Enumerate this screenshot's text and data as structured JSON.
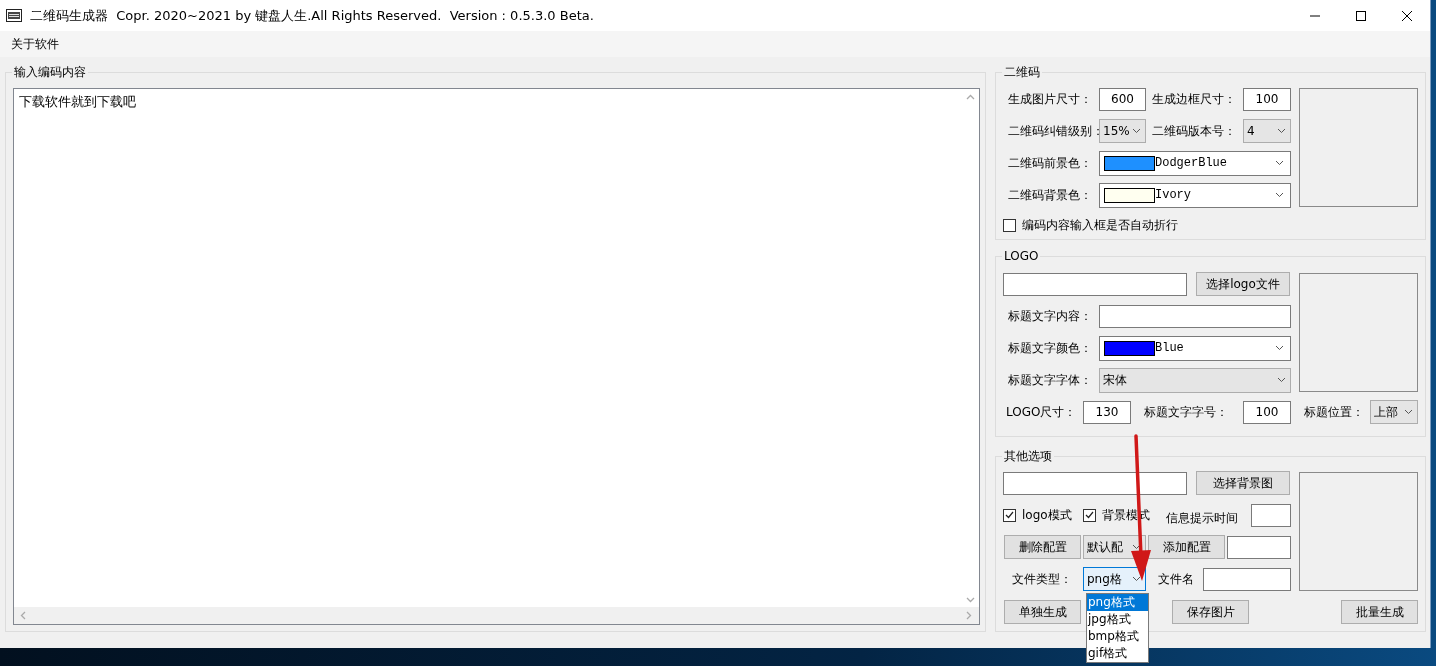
{
  "window": {
    "title": "二维码生成器  Copr. 2020~2021 by 键盘人生.All Rights Reserved.  Version : 0.5.3.0 Beta."
  },
  "menu": [
    {
      "label": "关于软件"
    }
  ],
  "input_group": {
    "title": "输入编码内容",
    "content": "下载软件就到下载吧"
  },
  "qr_code": {
    "title": "二维码",
    "image_size_label": "生成图片尺寸：",
    "image_size": "600",
    "border_size_label": "生成边框尺寸：",
    "border_size": "100",
    "error_level_label": "二维码纠错级别：",
    "error_level": "15%",
    "version_label": "二维码版本号：",
    "version": "4",
    "foreground_label": "二维码前景色：",
    "foreground": {
      "name": "DodgerBlue",
      "color": "#1e90ff"
    },
    "background_label": "二维码背景色：",
    "background": {
      "name": "Ivory",
      "color": "#fffff0"
    },
    "wrap_checkbox": {
      "label": "编码内容输入框是否自动折行",
      "checked": false
    }
  },
  "logo": {
    "title": "LOGO",
    "choose_button": "选择logo文件",
    "caption_label": "标题文字内容：",
    "color_label": "标题文字颜色：",
    "color": {
      "name": "Blue",
      "color": "#0000ff"
    },
    "font_label": "标题文字字体：",
    "font": "宋体",
    "size_label": "LOGO尺寸：",
    "size": "130",
    "font_size_label": "标题文字字号：",
    "font_size": "100",
    "position_label": "标题位置：",
    "position": "上部"
  },
  "other": {
    "title": "其他选项",
    "choose_button": "选择背景图",
    "checkboxes": [
      {
        "label": "logo模式",
        "checked": true
      },
      {
        "label": "背景模式",
        "checked": true
      }
    ],
    "tip_time_label": "信息提示时间",
    "delete_button": "删除配置",
    "config": "默认配",
    "add_button": "添加配置",
    "file_type_label": "文件类型：",
    "file_type": "png格",
    "file_name_label": "文件名",
    "single_button": "单独生成",
    "save_button": "保存图片",
    "batch_button": "批量生成"
  },
  "file_type_dropdown": {
    "options": [
      {
        "label": "png格式",
        "selected": true
      },
      {
        "label": "jpg格式",
        "selected": false
      },
      {
        "label": "bmp格式",
        "selected": false
      },
      {
        "label": "gif格式",
        "selected": false
      }
    ]
  }
}
